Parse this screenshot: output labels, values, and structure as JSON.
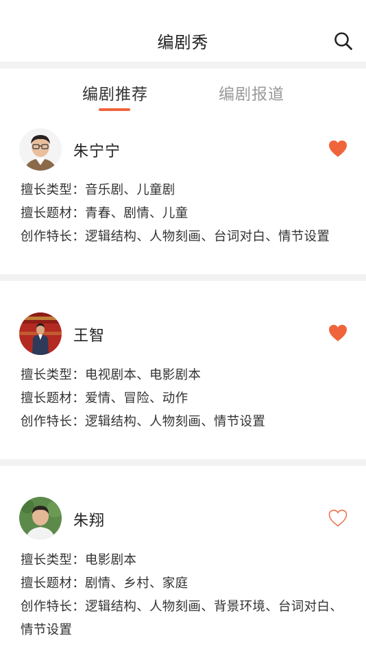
{
  "header": {
    "title": "编剧秀",
    "search_icon": "search-icon"
  },
  "tabs": [
    {
      "label": "编剧推荐",
      "active": true
    },
    {
      "label": "编剧报道",
      "active": false
    }
  ],
  "colors": {
    "accent": "#f0643c",
    "divider": "#f2f2f2",
    "inactive_tab": "#9a9a9a"
  },
  "writers": [
    {
      "name": "朱宁宁",
      "favorited": true,
      "types": "擅长类型：音乐剧、儿童剧",
      "topics": "擅长题材：青春、剧情、儿童",
      "strengths": "创作特长：逻辑结构、人物刻画、台词对白、情节设置"
    },
    {
      "name": "王智",
      "favorited": true,
      "types": "擅长类型：电视剧本、电影剧本",
      "topics": "擅长题材：爱情、冒险、动作",
      "strengths": "创作特长：逻辑结构、人物刻画、情节设置"
    },
    {
      "name": "朱翔",
      "favorited": false,
      "types": "擅长类型：电影剧本",
      "topics": "擅长题材：剧情、乡村、家庭",
      "strengths": "创作特长：逻辑结构、人物刻画、背景环境、台词对白、情节设置"
    }
  ]
}
